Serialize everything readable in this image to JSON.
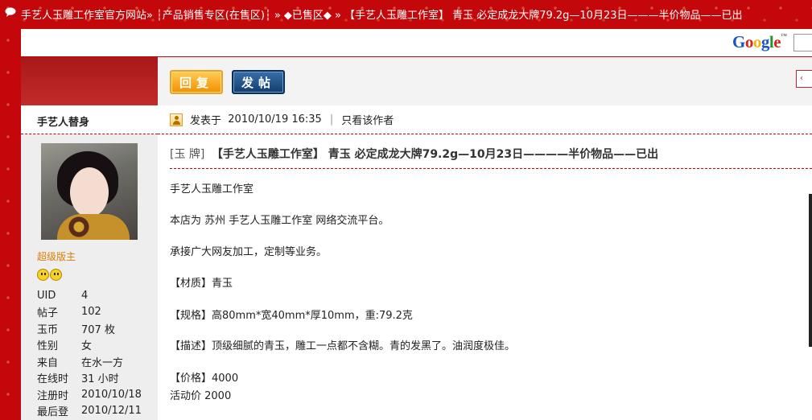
{
  "breadcrumb": {
    "items": [
      "手艺人玉雕工作室官方网站»",
      "┆产品销售专区(在售区)┆ »",
      "◆已售区◆ »",
      "【手艺人玉雕工作室】 青玉  必定成龙大牌79.2g—10月23日———半价物品——已出"
    ]
  },
  "google": {
    "logo": "Google",
    "tm": "™"
  },
  "toolbar": {
    "reply_label": "回复",
    "post_label": "发帖",
    "right_tab": "‹"
  },
  "author": {
    "name": "手艺人替身",
    "rank": "超级版主",
    "stats": [
      {
        "k": "UID",
        "v": "4"
      },
      {
        "k": "帖子",
        "v": "102"
      },
      {
        "k": "玉币",
        "v": "707 枚"
      },
      {
        "k": "性别",
        "v": "女"
      },
      {
        "k": "来自",
        "v": "在水一方"
      },
      {
        "k": "在线时",
        "v": "31 小时"
      },
      {
        "k": "注册时",
        "v": "2010/10/18"
      },
      {
        "k": "最后登",
        "v": "2010/12/11"
      }
    ]
  },
  "post": {
    "posted_prefix": "发表于",
    "posted_time": "2010/10/19 16:35",
    "sep": "|",
    "author_only": "只看该作者",
    "tag": "[玉 牌]",
    "title": "【手艺人玉雕工作室】 青玉  必定成龙大牌79.2g—10月23日————半价物品——已出",
    "lines": [
      "手艺人玉雕工作室",
      "本店为 苏州 手艺人玉雕工作室  网络交流平台。",
      "承接广大网友加工，定制等业务。",
      "【材质】青玉",
      "【规格】高80mm*宽40mm*厚10mm，重:79.2克",
      "【描述】顶级细腻的青玉，雕工一点都不含糊。青的发黑了。油润度极佳。",
      "【价格】4000",
      "活动价  2000"
    ]
  }
}
